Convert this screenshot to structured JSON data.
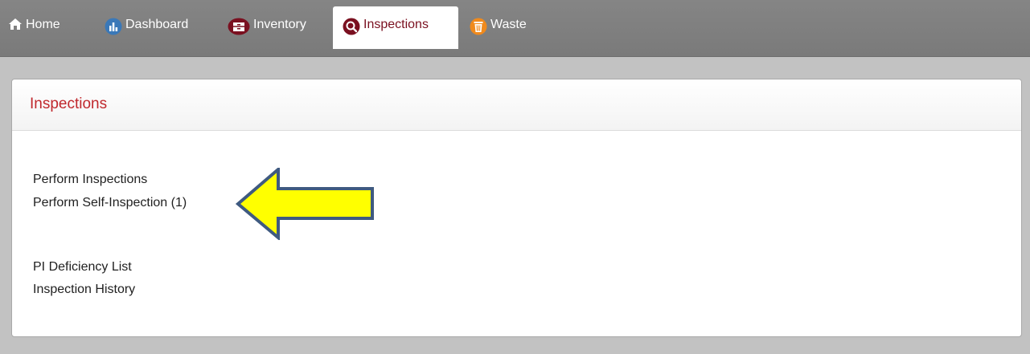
{
  "nav": {
    "items": [
      {
        "label": "Home",
        "icon": "home-icon"
      },
      {
        "label": "Dashboard",
        "icon": "chart-icon"
      },
      {
        "label": "Inventory",
        "icon": "cabinet-icon"
      },
      {
        "label": "Inspections",
        "icon": "magnifier-icon",
        "active": true
      },
      {
        "label": "Waste",
        "icon": "trash-can-icon"
      }
    ]
  },
  "panel": {
    "title": "Inspections",
    "links": [
      {
        "label": "Perform Inspections"
      },
      {
        "label": "Perform Self-Inspection (1)"
      },
      {
        "label": "PI Deficiency List"
      },
      {
        "label": "Inspection History"
      }
    ]
  },
  "colors": {
    "nav_bg": "#7f7f7f",
    "active_tab_text": "#7a1020",
    "panel_title": "#c0282d",
    "arrow_fill": "#ffff00",
    "arrow_stroke": "#3f5a80"
  }
}
